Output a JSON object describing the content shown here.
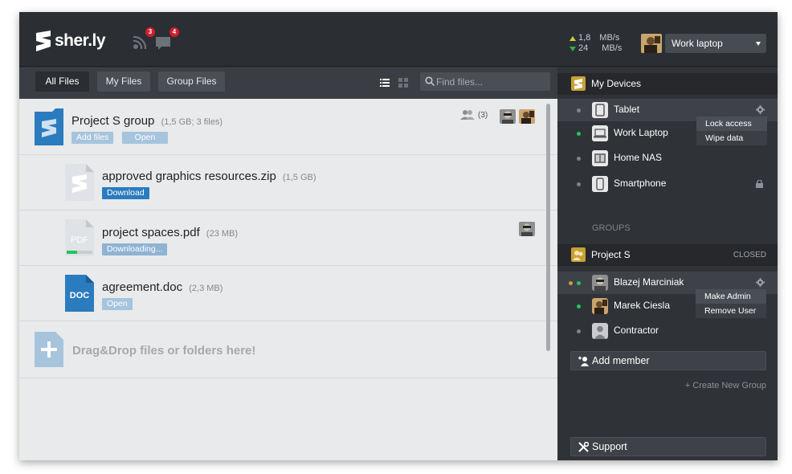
{
  "app": {
    "brand": "sher.ly"
  },
  "topbar": {
    "notifications": [
      {
        "icon": "broadcast-icon",
        "count": "3"
      },
      {
        "icon": "chat-icon",
        "count": "4"
      }
    ],
    "speed": {
      "up": "1,8",
      "down": "24",
      "unit": "MB/s"
    },
    "device_selector": {
      "value": "Work laptop"
    }
  },
  "toolbar": {
    "tabs": [
      {
        "label": "All Files",
        "active": true
      },
      {
        "label": "My Files",
        "active": false
      },
      {
        "label": "Group Files",
        "active": false
      }
    ],
    "search": {
      "placeholder": "Find files..."
    }
  },
  "files": {
    "group": {
      "name": "Project S group",
      "meta": "(1,5 GB; 3 files)",
      "member_count": "(3)",
      "actions": {
        "add": "Add files",
        "open": "Open"
      }
    },
    "items": [
      {
        "name": "approved graphics resources.zip",
        "size": "(1,5 GB)",
        "type": "zip",
        "action": "Download",
        "action_style": "dark"
      },
      {
        "name": "project spaces.pdf",
        "size": "(23 MB)",
        "type": "PDF",
        "action": "Downloading...",
        "action_style": "light",
        "progress": 0.4
      },
      {
        "name": "agreement.doc",
        "size": "(2,3 MB)",
        "type": "DOC",
        "action": "Open",
        "action_style": "light"
      }
    ],
    "dropzone": "Drag&Drop files or folders here!"
  },
  "sidebar": {
    "devices_title": "My Devices",
    "devices": [
      {
        "name": "Tablet",
        "status": "offline",
        "icon": "tablet-icon"
      },
      {
        "name": "Work Laptop",
        "status": "online",
        "icon": "laptop-icon"
      },
      {
        "name": "Home NAS",
        "status": "offline",
        "icon": "nas-icon"
      },
      {
        "name": "Smartphone",
        "status": "offline",
        "icon": "smartphone-icon"
      }
    ],
    "device_menu": [
      "Lock access",
      "Wipe data"
    ],
    "groups_label": "GROUPS",
    "group": {
      "name": "Project S",
      "status": "CLOSED"
    },
    "members": [
      {
        "name": "Blazej Marciniak"
      },
      {
        "name": "Marek Ciesla"
      },
      {
        "name": "Contractor"
      }
    ],
    "member_menu": [
      "Make Admin",
      "Remove User"
    ],
    "add_member": "Add member",
    "create_group": "+ Create New Group",
    "support": "Support"
  },
  "colors": {
    "accent": "#2b7bbf",
    "online": "#22c55e",
    "badge": "#d0202c"
  }
}
